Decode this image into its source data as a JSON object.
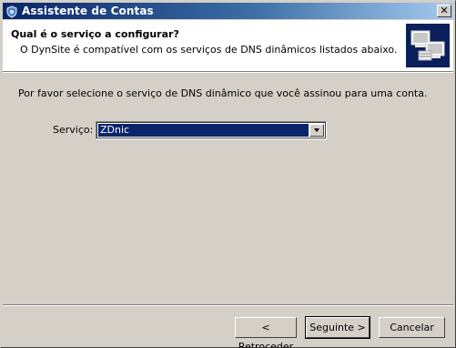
{
  "window": {
    "title": "Assistente de Contas",
    "close_label": "✕"
  },
  "header": {
    "title": "Qual é o serviço a configurar?",
    "subtitle": "O DynSite é compatível com os serviços de DNS dinâmicos listados abaixo."
  },
  "main": {
    "prompt": "Por favor selecione o serviço de DNS dinâmico que você assinou para uma conta.",
    "service_label": "Serviço:",
    "service_value": "ZDnic"
  },
  "footer": {
    "back_label": "< Retroceder",
    "next_label": "Seguinte >",
    "cancel_label": "Cancelar"
  },
  "colors": {
    "titlebar_start": "#0a246a",
    "titlebar_end": "#a6caf0",
    "selection": "#0a246a",
    "face": "#d4d0c8"
  },
  "icons": {
    "title": "shield-globe-icon",
    "header_art": "network-computers-icon",
    "close": "close-icon",
    "dropdown": "chevron-down-icon"
  }
}
